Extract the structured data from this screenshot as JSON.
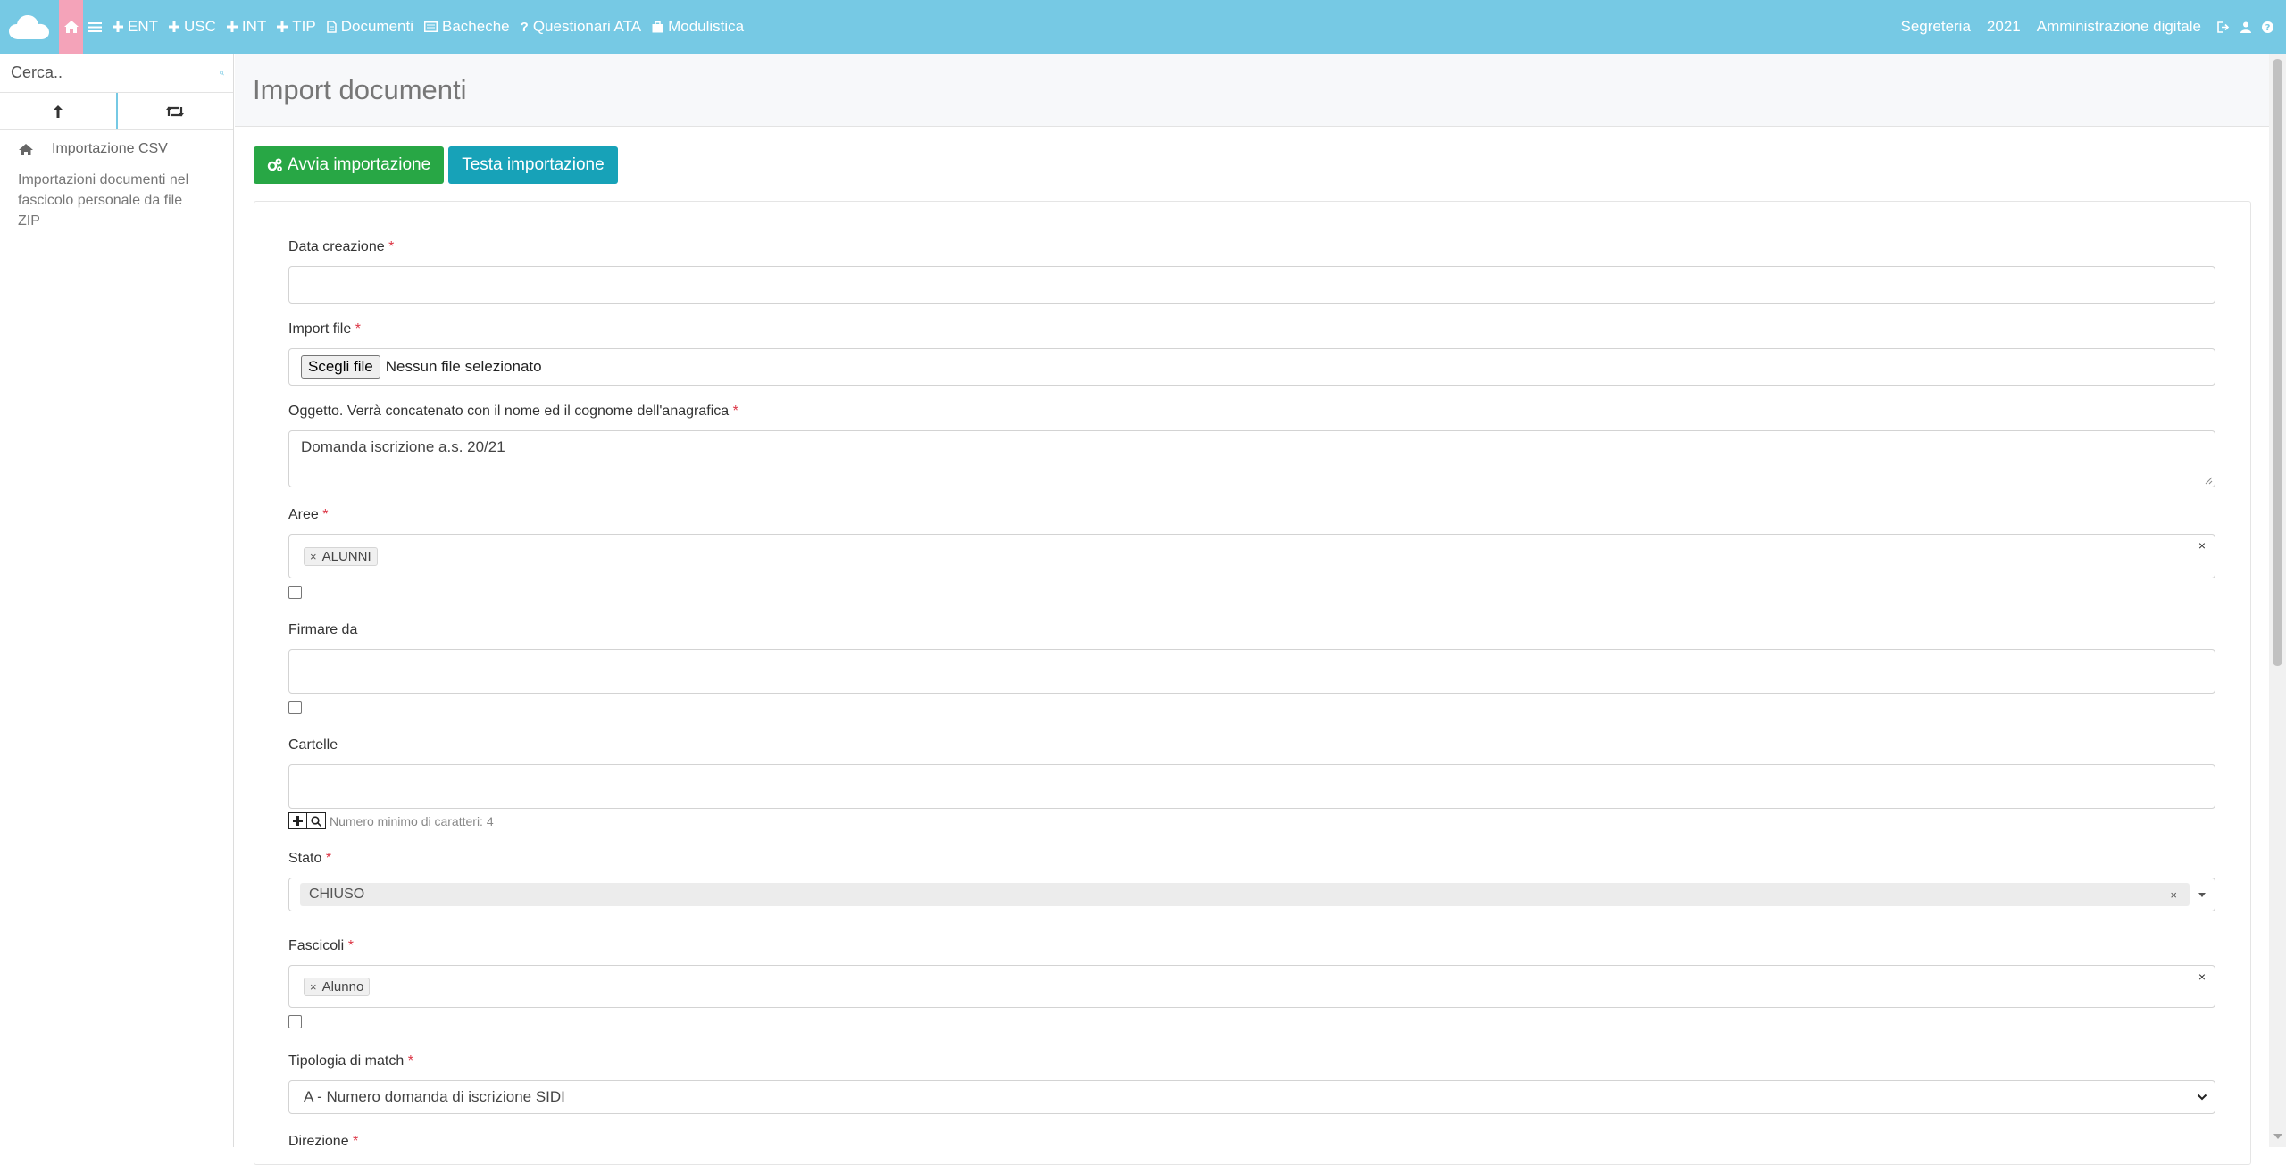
{
  "topbar": {
    "nav": [
      {
        "icon": "plus-icon",
        "label": "ENT"
      },
      {
        "icon": "plus-icon",
        "label": "USC"
      },
      {
        "icon": "plus-icon",
        "label": "INT"
      },
      {
        "icon": "plus-icon",
        "label": "TIP"
      },
      {
        "icon": "file-icon",
        "label": "Documenti"
      },
      {
        "icon": "board-icon",
        "label": "Bacheche"
      },
      {
        "icon": "question-icon",
        "label": "Questionari ATA"
      },
      {
        "icon": "briefcase-icon",
        "label": "Modulistica"
      }
    ],
    "right": {
      "office": "Segreteria",
      "year": "2021",
      "app": "Amministrazione digitale"
    },
    "colors": {
      "bar": "#76c9e4",
      "home": "#f4a3b9"
    }
  },
  "sidebar": {
    "search_placeholder": "Cerca..",
    "item_label": "Importazione CSV",
    "description": "Importazioni documenti nel fascicolo personale da file ZIP"
  },
  "page": {
    "title": "Import documenti",
    "btn_start": "Avvia importazione",
    "btn_test": "Testa importazione"
  },
  "form": {
    "data_creazione": {
      "label": "Data creazione",
      "value": ""
    },
    "import_file": {
      "label": "Import file",
      "button": "Scegli file",
      "status": "Nessun file selezionato"
    },
    "oggetto": {
      "label": "Oggetto. Verrà concatenato con il nome ed il cognome dell'anagrafica",
      "value": "Domanda iscrizione a.s. 20/21"
    },
    "aree": {
      "label": "Aree",
      "tags": [
        "ALUNNI"
      ]
    },
    "firmare_da": {
      "label": "Firmare da"
    },
    "cartelle": {
      "label": "Cartelle",
      "hint": "Numero minimo di caratteri: 4"
    },
    "stato": {
      "label": "Stato",
      "value": "CHIUSO"
    },
    "fascicoli": {
      "label": "Fascicoli",
      "tags": [
        "Alunno"
      ]
    },
    "tipologia": {
      "label": "Tipologia di match",
      "value": "A - Numero domanda di iscrizione SIDI"
    },
    "direzione": {
      "label": "Direzione"
    }
  },
  "required_mark": "*",
  "clear_mark": "×"
}
